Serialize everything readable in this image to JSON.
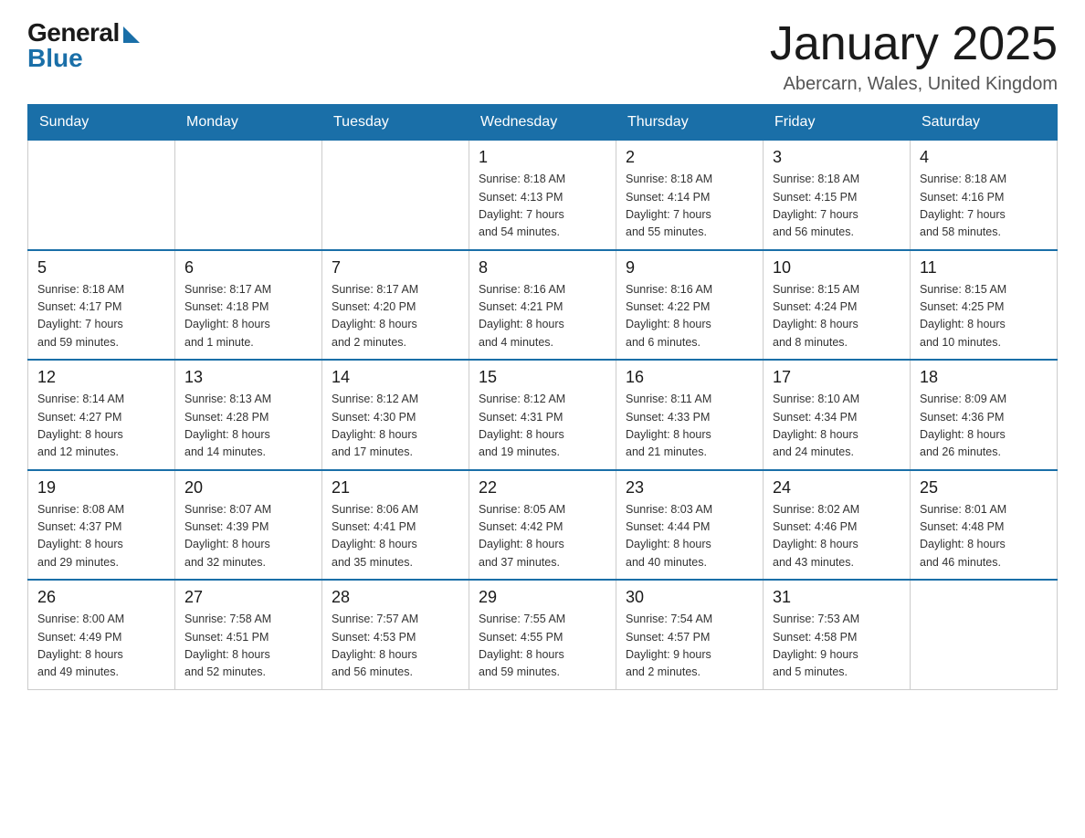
{
  "header": {
    "logo_general": "General",
    "logo_blue": "Blue",
    "month_title": "January 2025",
    "location": "Abercarn, Wales, United Kingdom"
  },
  "days_of_week": [
    "Sunday",
    "Monday",
    "Tuesday",
    "Wednesday",
    "Thursday",
    "Friday",
    "Saturday"
  ],
  "weeks": [
    [
      {
        "day": "",
        "info": ""
      },
      {
        "day": "",
        "info": ""
      },
      {
        "day": "",
        "info": ""
      },
      {
        "day": "1",
        "info": "Sunrise: 8:18 AM\nSunset: 4:13 PM\nDaylight: 7 hours\nand 54 minutes."
      },
      {
        "day": "2",
        "info": "Sunrise: 8:18 AM\nSunset: 4:14 PM\nDaylight: 7 hours\nand 55 minutes."
      },
      {
        "day": "3",
        "info": "Sunrise: 8:18 AM\nSunset: 4:15 PM\nDaylight: 7 hours\nand 56 minutes."
      },
      {
        "day": "4",
        "info": "Sunrise: 8:18 AM\nSunset: 4:16 PM\nDaylight: 7 hours\nand 58 minutes."
      }
    ],
    [
      {
        "day": "5",
        "info": "Sunrise: 8:18 AM\nSunset: 4:17 PM\nDaylight: 7 hours\nand 59 minutes."
      },
      {
        "day": "6",
        "info": "Sunrise: 8:17 AM\nSunset: 4:18 PM\nDaylight: 8 hours\nand 1 minute."
      },
      {
        "day": "7",
        "info": "Sunrise: 8:17 AM\nSunset: 4:20 PM\nDaylight: 8 hours\nand 2 minutes."
      },
      {
        "day": "8",
        "info": "Sunrise: 8:16 AM\nSunset: 4:21 PM\nDaylight: 8 hours\nand 4 minutes."
      },
      {
        "day": "9",
        "info": "Sunrise: 8:16 AM\nSunset: 4:22 PM\nDaylight: 8 hours\nand 6 minutes."
      },
      {
        "day": "10",
        "info": "Sunrise: 8:15 AM\nSunset: 4:24 PM\nDaylight: 8 hours\nand 8 minutes."
      },
      {
        "day": "11",
        "info": "Sunrise: 8:15 AM\nSunset: 4:25 PM\nDaylight: 8 hours\nand 10 minutes."
      }
    ],
    [
      {
        "day": "12",
        "info": "Sunrise: 8:14 AM\nSunset: 4:27 PM\nDaylight: 8 hours\nand 12 minutes."
      },
      {
        "day": "13",
        "info": "Sunrise: 8:13 AM\nSunset: 4:28 PM\nDaylight: 8 hours\nand 14 minutes."
      },
      {
        "day": "14",
        "info": "Sunrise: 8:12 AM\nSunset: 4:30 PM\nDaylight: 8 hours\nand 17 minutes."
      },
      {
        "day": "15",
        "info": "Sunrise: 8:12 AM\nSunset: 4:31 PM\nDaylight: 8 hours\nand 19 minutes."
      },
      {
        "day": "16",
        "info": "Sunrise: 8:11 AM\nSunset: 4:33 PM\nDaylight: 8 hours\nand 21 minutes."
      },
      {
        "day": "17",
        "info": "Sunrise: 8:10 AM\nSunset: 4:34 PM\nDaylight: 8 hours\nand 24 minutes."
      },
      {
        "day": "18",
        "info": "Sunrise: 8:09 AM\nSunset: 4:36 PM\nDaylight: 8 hours\nand 26 minutes."
      }
    ],
    [
      {
        "day": "19",
        "info": "Sunrise: 8:08 AM\nSunset: 4:37 PM\nDaylight: 8 hours\nand 29 minutes."
      },
      {
        "day": "20",
        "info": "Sunrise: 8:07 AM\nSunset: 4:39 PM\nDaylight: 8 hours\nand 32 minutes."
      },
      {
        "day": "21",
        "info": "Sunrise: 8:06 AM\nSunset: 4:41 PM\nDaylight: 8 hours\nand 35 minutes."
      },
      {
        "day": "22",
        "info": "Sunrise: 8:05 AM\nSunset: 4:42 PM\nDaylight: 8 hours\nand 37 minutes."
      },
      {
        "day": "23",
        "info": "Sunrise: 8:03 AM\nSunset: 4:44 PM\nDaylight: 8 hours\nand 40 minutes."
      },
      {
        "day": "24",
        "info": "Sunrise: 8:02 AM\nSunset: 4:46 PM\nDaylight: 8 hours\nand 43 minutes."
      },
      {
        "day": "25",
        "info": "Sunrise: 8:01 AM\nSunset: 4:48 PM\nDaylight: 8 hours\nand 46 minutes."
      }
    ],
    [
      {
        "day": "26",
        "info": "Sunrise: 8:00 AM\nSunset: 4:49 PM\nDaylight: 8 hours\nand 49 minutes."
      },
      {
        "day": "27",
        "info": "Sunrise: 7:58 AM\nSunset: 4:51 PM\nDaylight: 8 hours\nand 52 minutes."
      },
      {
        "day": "28",
        "info": "Sunrise: 7:57 AM\nSunset: 4:53 PM\nDaylight: 8 hours\nand 56 minutes."
      },
      {
        "day": "29",
        "info": "Sunrise: 7:55 AM\nSunset: 4:55 PM\nDaylight: 8 hours\nand 59 minutes."
      },
      {
        "day": "30",
        "info": "Sunrise: 7:54 AM\nSunset: 4:57 PM\nDaylight: 9 hours\nand 2 minutes."
      },
      {
        "day": "31",
        "info": "Sunrise: 7:53 AM\nSunset: 4:58 PM\nDaylight: 9 hours\nand 5 minutes."
      },
      {
        "day": "",
        "info": ""
      }
    ]
  ]
}
